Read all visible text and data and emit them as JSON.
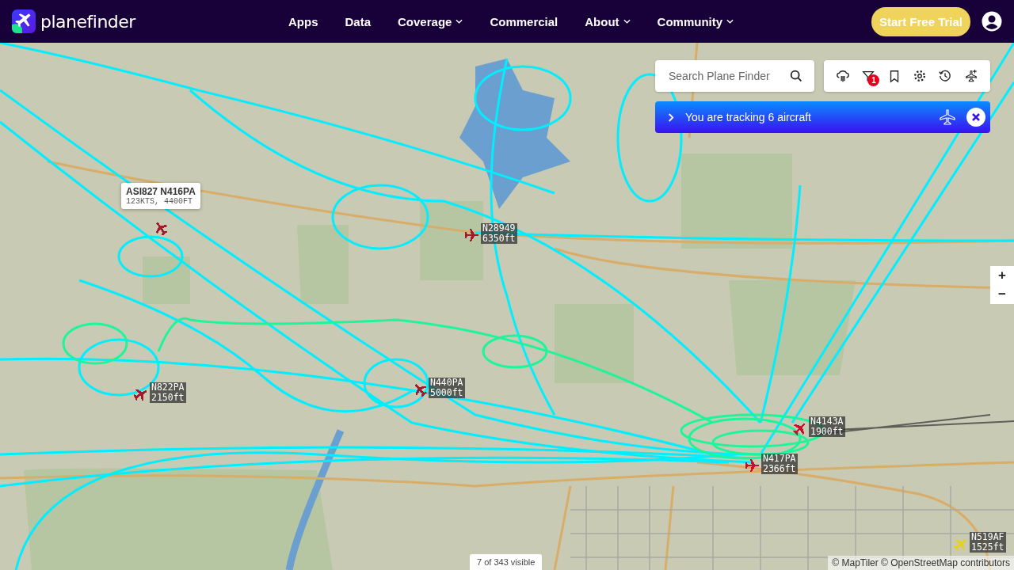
{
  "header": {
    "brand": "planefinder",
    "nav": [
      {
        "label": "Apps",
        "dropdown": false
      },
      {
        "label": "Data",
        "dropdown": false
      },
      {
        "label": "Coverage",
        "dropdown": true
      },
      {
        "label": "Commercial",
        "dropdown": false
      },
      {
        "label": "About",
        "dropdown": true
      },
      {
        "label": "Community",
        "dropdown": true
      }
    ],
    "cta": "Start Free Trial"
  },
  "search": {
    "placeholder": "Search Plane Finder"
  },
  "toolbar": {
    "filter_badge": "1"
  },
  "tracking_banner": {
    "text": "You are tracking 6 aircraft"
  },
  "zoom": {
    "in": "+",
    "out": "−"
  },
  "aircraft": [
    {
      "kind": "popup",
      "lines": [
        "ASI827 N416PA",
        "123KTS, 4400FT"
      ],
      "color": "#a3182b"
    },
    {
      "kind": "tag",
      "lines": [
        "N28949",
        "6350ft"
      ],
      "color": "#a3182b"
    },
    {
      "kind": "tag",
      "lines": [
        "N822PA",
        "2150ft"
      ],
      "color": "#a3182b"
    },
    {
      "kind": "tag",
      "lines": [
        "N440PA",
        "5000ft"
      ],
      "color": "#a3182b"
    },
    {
      "kind": "tag",
      "lines": [
        "N4143A",
        "1900ft"
      ],
      "color": "#c8102e"
    },
    {
      "kind": "tag",
      "lines": [
        "N417PA",
        "2366ft"
      ],
      "color": "#c8102e"
    },
    {
      "kind": "tag",
      "lines": [
        "N519AF",
        "1525ft"
      ],
      "color": "#e6d21e"
    }
  ],
  "visible_count": "7 of 343 visible",
  "attribution": "© MapTiler © OpenStreetMap contributors"
}
